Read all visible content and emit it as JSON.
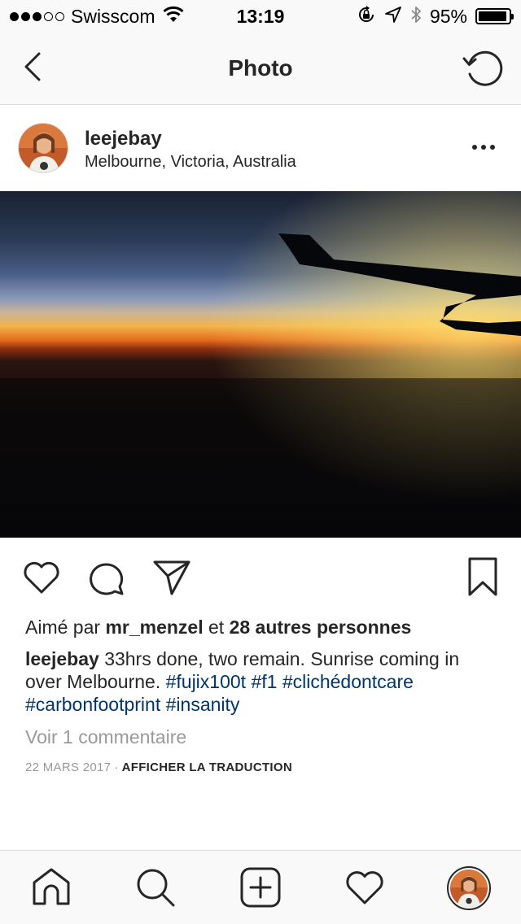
{
  "status_bar": {
    "signal_filled": 3,
    "signal_total": 5,
    "carrier": "Swisscom",
    "time": "13:19",
    "battery_percent": "95%",
    "battery_level": 0.95,
    "icons": [
      "wifi-icon",
      "rotation-lock-icon",
      "location-arrow-icon",
      "bluetooth-icon",
      "battery-icon"
    ]
  },
  "nav": {
    "title": "Photo",
    "back_icon": "chevron-left-icon",
    "refresh_icon": "refresh-icon"
  },
  "post": {
    "username": "leejebay",
    "location": "Melbourne, Victoria, Australia",
    "more_icon": "more-dots-icon",
    "photo_description": "sunrise-horizon-airplane-wing"
  },
  "actions": {
    "like_icon": "heart-icon",
    "comment_icon": "comment-icon",
    "share_icon": "paper-plane-icon",
    "save_icon": "bookmark-icon"
  },
  "likes": {
    "prefix": "Aimé par",
    "user": "mr_menzel",
    "middle": "et",
    "others": "28 autres personnes"
  },
  "caption": {
    "user": "leejebay",
    "text": "33hrs done, two remain. Sunrise coming in over Melbourne.",
    "tags": [
      "#fujix100t",
      "#f1",
      "#clichédontcare",
      "#carbonfootprint",
      "#insanity"
    ]
  },
  "comments_link": "Voir 1 commentaire",
  "meta": {
    "date": "22 MARS 2017",
    "separator": "·",
    "translate": "AFFICHER LA TRADUCTION"
  },
  "tab_bar": {
    "items": [
      "home-icon",
      "search-icon",
      "add-post-icon",
      "activity-heart-icon",
      "profile-avatar"
    ]
  },
  "colors": {
    "hashtag": "#003569",
    "text": "#262626",
    "muted": "#999999",
    "bar_bg": "#f9f9f9",
    "divider": "#dbdbdb"
  }
}
